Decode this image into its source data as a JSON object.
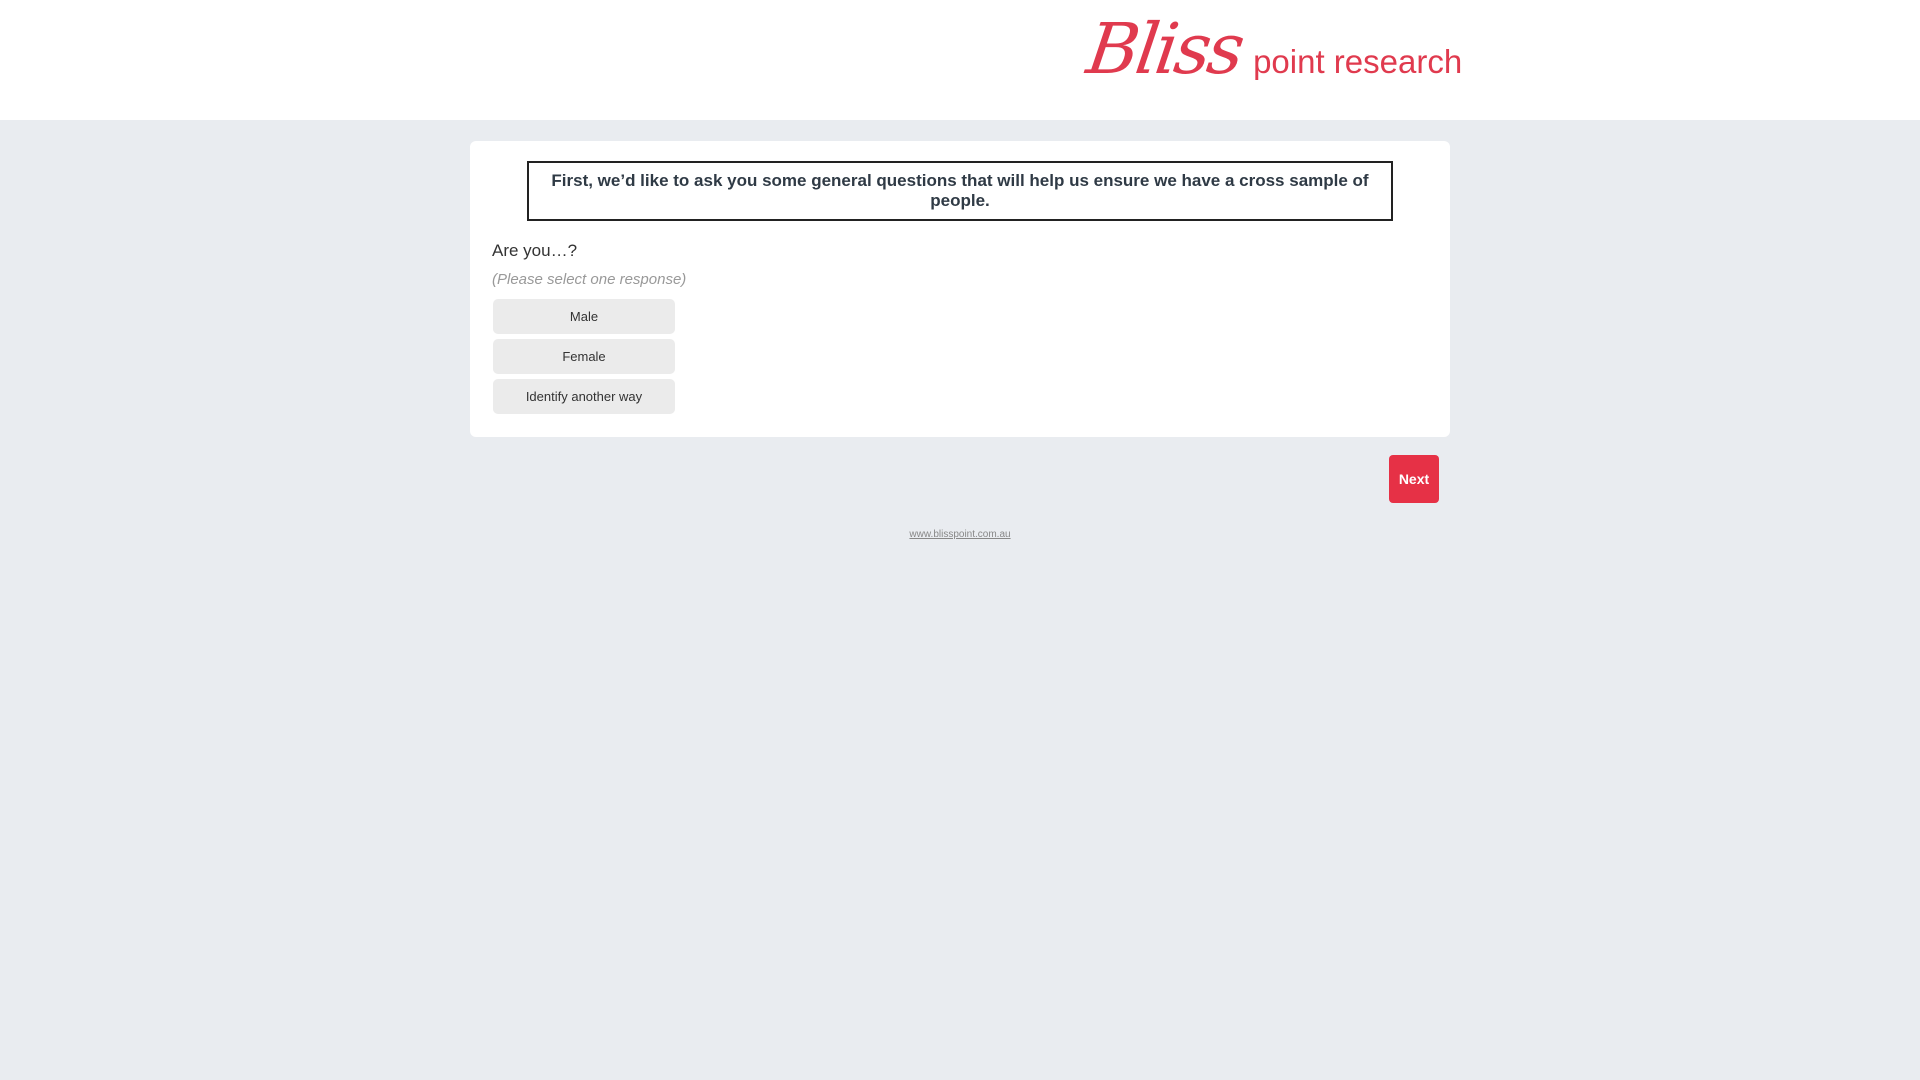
{
  "header": {
    "logo": {
      "script": "Bliss",
      "subtitle": "point research",
      "color": "#e03a4e"
    }
  },
  "survey": {
    "intro": "First, we’d like to ask you some general questions that will help us ensure we have a cross sample of people.",
    "question": "Are you…?",
    "instruction": "(Please select one response)",
    "options": [
      "Male",
      "Female",
      "Identify another way"
    ]
  },
  "navigation": {
    "next_label": "Next",
    "next_color": "#e63146"
  },
  "footer": {
    "link_text": "www.blisspoint.com.au"
  },
  "colors": {
    "page_background": "#e9ecf0",
    "card_background": "#ffffff",
    "option_background": "#ebebeb"
  }
}
